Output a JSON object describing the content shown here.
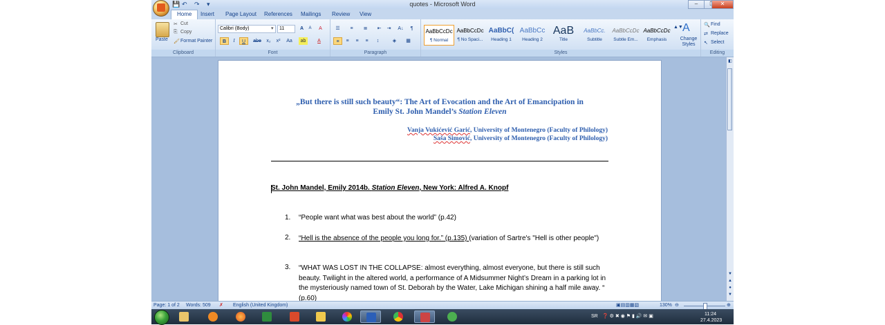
{
  "window": {
    "title": "quotes - Microsoft Word",
    "minimize": "–",
    "maximize": "❐",
    "close": "✕"
  },
  "tabs": [
    {
      "label": "Home"
    },
    {
      "label": "Insert"
    },
    {
      "label": "Page Layout"
    },
    {
      "label": "References"
    },
    {
      "label": "Mailings"
    },
    {
      "label": "Review"
    },
    {
      "label": "View"
    }
  ],
  "ribbon": {
    "clipboard": {
      "label": "Clipboard",
      "paste": "Paste",
      "cut": "Cut",
      "copy": "Copy",
      "format_painter": "Format Painter"
    },
    "font": {
      "label": "Font",
      "family": "Calibri (Body)",
      "size": "11",
      "bold": "B",
      "italic": "I",
      "underline": "U",
      "strike": "abe",
      "sub": "x₂",
      "sup": "x²",
      "case": "Aa",
      "grow": "A",
      "shrink": "A",
      "clear": "A",
      "highlight": "ab",
      "color": "A"
    },
    "paragraph": {
      "label": "Paragraph",
      "sort": "A↓",
      "show": "¶"
    },
    "styles": {
      "label": "Styles",
      "items": [
        {
          "preview": "AaBbCcDc",
          "name": "¶ Normal"
        },
        {
          "preview": "AaBbCcDc",
          "name": "¶ No Spaci..."
        },
        {
          "preview": "AaBbC(",
          "name": "Heading 1"
        },
        {
          "preview": "AaBbCc",
          "name": "Heading 2"
        },
        {
          "preview": "AaB",
          "name": "Title"
        },
        {
          "preview": "AaBbCc.",
          "name": "Subtitle"
        },
        {
          "preview": "AaBbCcDc",
          "name": "Subtle Em..."
        },
        {
          "preview": "AaBbCcDc",
          "name": "Emphasis"
        }
      ],
      "change": "Change Styles"
    },
    "editing": {
      "label": "Editing",
      "find": "Find",
      "replace": "Replace",
      "select": "Select"
    }
  },
  "document": {
    "title_line1": "„But there is still such beauty“: The Art of Evocation and the Art of Emancipation in",
    "title_line2_prefix": "Emily St. John Mandel’s ",
    "title_line2_italic": "Station Eleven",
    "author1_name": "Vanja Vukićević Garić",
    "author1_rest": ", University of Montenegro (Faculty of Philology)",
    "author2_name": "Saša Simović",
    "author2_rest": ", University of Montenegro (Faculty of Philology)",
    "source_prefix": "St. John Mandel, Emily 2014b. ",
    "source_italic": "Station Eleven",
    "source_suffix": ", New York: Alfred A. Knopf",
    "quotes": [
      {
        "num": "1.",
        "text": "“People want what was best about the world” (p.42)"
      },
      {
        "num": "2.",
        "text_underlined": "“Hell is the absence of the people you long for.” (p.135) ",
        "text": "(variation of Sartre's \"Hell is other people\")"
      },
      {
        "num": "3.",
        "text": "“WHAT WAS LOST IN THE COLLAPSE: almost everything, almost everyone, but there is still such beauty. Twilight in the altered world, a performance of A Midsummer Night’s Dream in a parking lot in the mysteriously named town of St. Deborah by the Water, Lake Michigan shining a half mile away. “ (p.60)"
      }
    ]
  },
  "statusbar": {
    "page": "Page: 1 of 2",
    "words": "Words: 509",
    "language": "English (United Kingdom)",
    "zoom": "130%"
  },
  "tray": {
    "lang": "SR",
    "time": "11:24",
    "date": "27.4.2023"
  }
}
